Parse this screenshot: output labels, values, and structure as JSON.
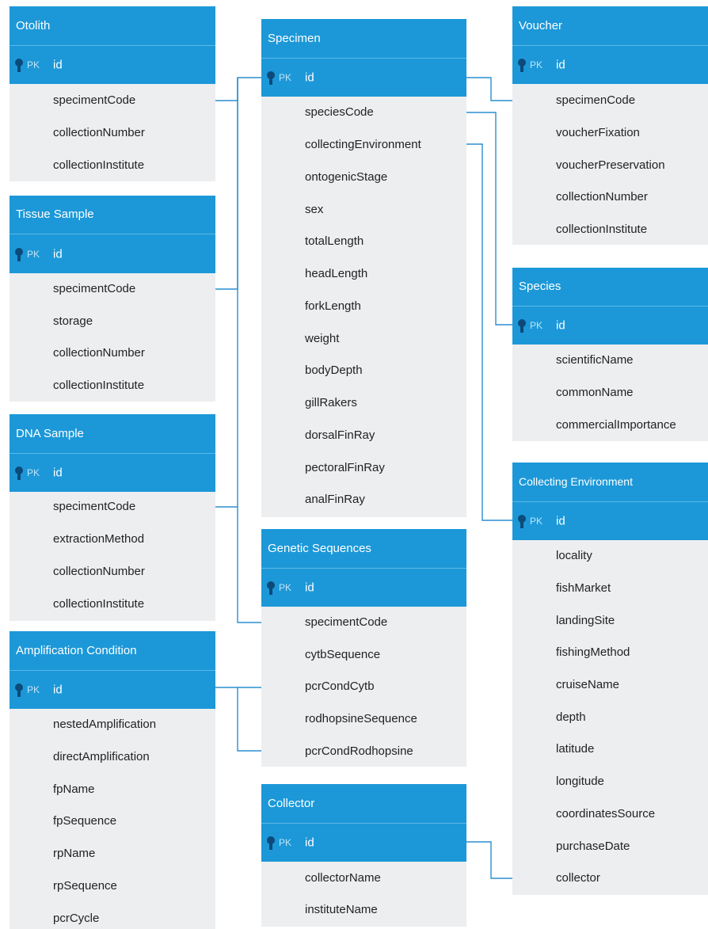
{
  "colors": {
    "header": "#1c98d8",
    "body": "#edeef0",
    "connector": "#2a8fd0"
  },
  "pk_label": "PK",
  "entities": {
    "otolith": {
      "title": "Otolith",
      "pk": "id",
      "fields": [
        "specimentCode",
        "collectionNumber",
        "collectionInstitute"
      ]
    },
    "tissue": {
      "title": "Tissue Sample",
      "pk": "id",
      "fields": [
        "specimentCode",
        "storage",
        "collectionNumber",
        "collectionInstitute"
      ]
    },
    "dna": {
      "title": "DNA Sample",
      "pk": "id",
      "fields": [
        "specimentCode",
        "extractionMethod",
        "collectionNumber",
        "collectionInstitute"
      ]
    },
    "amplification": {
      "title": "Amplification Condition",
      "pk": "id",
      "fields": [
        "nestedAmplification",
        "directAmplification",
        "fpName",
        "fpSequence",
        "rpName",
        "rpSequence",
        "pcrCycle"
      ]
    },
    "specimen": {
      "title": "Specimen",
      "pk": "id",
      "fields": [
        "speciesCode",
        "collectingEnvironment",
        "ontogenicStage",
        "sex",
        "totalLength",
        "headLength",
        "forkLength",
        "weight",
        "bodyDepth",
        "gillRakers",
        "dorsalFinRay",
        "pectoralFinRay",
        "analFinRay"
      ]
    },
    "genetic": {
      "title": "Genetic Sequences",
      "pk": "id",
      "fields": [
        "specimentCode",
        "cytbSequence",
        "pcrCondCytb",
        "rodhopsineSequence",
        "pcrCondRodhopsine"
      ]
    },
    "collector": {
      "title": "Collector",
      "pk": "id",
      "fields": [
        "collectorName",
        "instituteName"
      ]
    },
    "voucher": {
      "title": "Voucher",
      "pk": "id",
      "fields": [
        "specimenCode",
        "voucherFixation",
        "voucherPreservation",
        "collectionNumber",
        "collectionInstitute"
      ]
    },
    "species": {
      "title": "Species",
      "pk": "id",
      "fields": [
        "scientificName",
        "commonName",
        "commercialImportance"
      ]
    },
    "environment": {
      "title": "Collecting Environment",
      "pk": "id",
      "fields": [
        "locality",
        "fishMarket",
        "landingSite",
        "fishingMethod",
        "cruiseName",
        "depth",
        "latitude",
        "longitude",
        "coordinatesSource",
        "purchaseDate",
        "collector"
      ]
    }
  }
}
